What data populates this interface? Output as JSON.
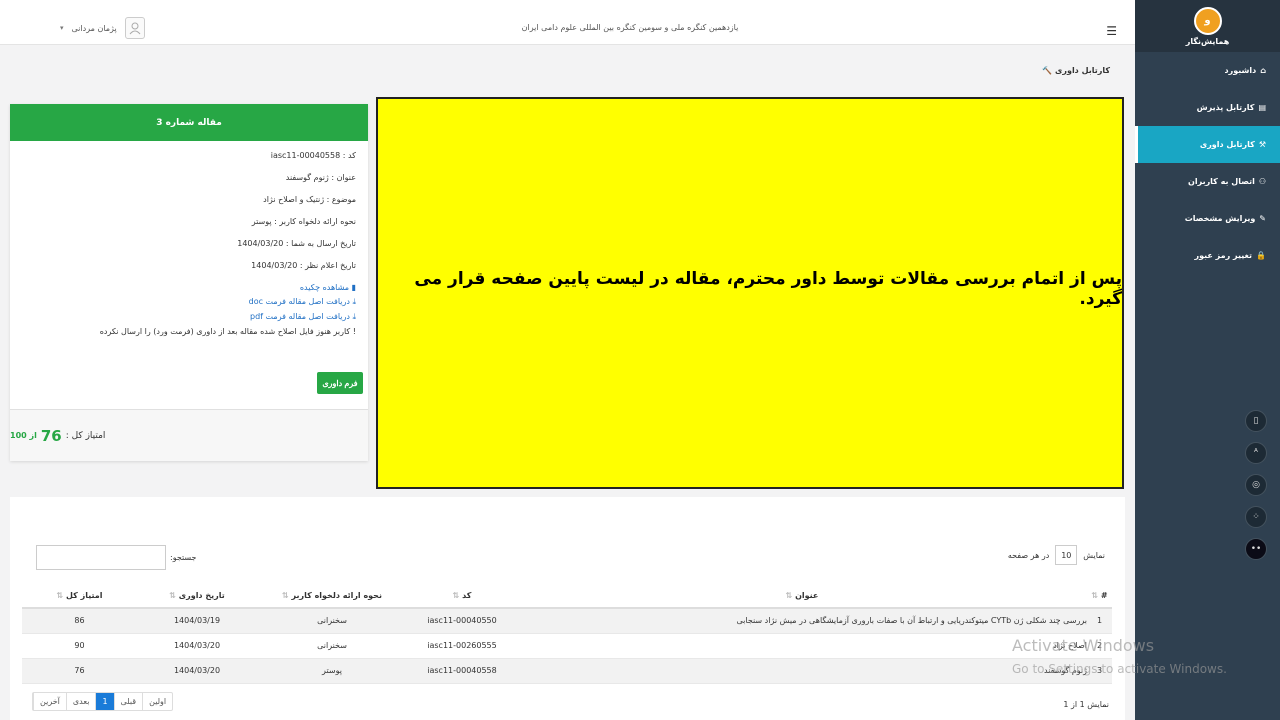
{
  "topbar": {
    "conference": "یازدهمین کنگره ملی و سومین کنگره بین المللی علوم دامی ایران",
    "user": "پژمان مردانی"
  },
  "breadcrumb": "کارتابل داوری",
  "sidebar": {
    "logo_text": "همایش‌نگار",
    "items": [
      {
        "label": "داشبورد",
        "icon": "home-icon"
      },
      {
        "label": "کارتابل پذیرش",
        "icon": "file-icon"
      },
      {
        "label": "کارتابل داوری",
        "icon": "gavel-icon",
        "active": true
      },
      {
        "label": "اتصال به کاربران",
        "icon": "users-icon"
      },
      {
        "label": "ویرایش مشخصات",
        "icon": "edit-icon"
      },
      {
        "label": "تغییر رمز عبور",
        "icon": "lock-icon"
      }
    ]
  },
  "card": {
    "title": "مقاله شماره 3",
    "code": "کد : iasc11-00040558",
    "title_field": "عنوان : ژنوم گوسفند",
    "subject": "موضوع : ژنتیک و اصلاح نژاد",
    "presentation": "نحوه ارائه دلخواه کاربر : پوستر",
    "sent_date": "تاریخ ارسال به شما : 1404/03/20",
    "opinion_date": "تاریخ اعلام نظر : 1404/03/20",
    "link_abstract": "مشاهده چکیده",
    "link_doc": "دریافت اصل مقاله فرمت doc",
    "link_pdf": "دریافت اصل مقاله فرمت pdf",
    "warning": "کاربر هنوز فایل اصلاح شده مقاله بعد از داوری (فرمت ورد) را ارسال نکرده",
    "review_button": "فرم داوری",
    "score_label": "امتیاز کل :",
    "score": "76",
    "score_of": "از 100"
  },
  "notice": "پس از اتمام بررسی مقالات توسط داور محترم، مقاله در لیست پایین صفحه قرار می گیرد.",
  "table": {
    "length_prefix": "نمایش",
    "length_value": "10",
    "length_suffix": "در هر صفحه",
    "search_label": "جستجو:",
    "headers": {
      "num": "#",
      "title": "عنوان",
      "code": "کد",
      "presentation": "نحوه ارائه دلخواه کاربر",
      "date": "تاریخ داوری",
      "score": "امتیاز کل"
    },
    "rows": [
      {
        "num": "1",
        "title": "بررسی چند شکلی ژن CYTb میتوکندریایی و ارتباط آن با صفات باروری آزمایشگاهی در میش نژاد سنجابی",
        "code": "iasc11-00040550",
        "presentation": "سخنرانی",
        "date": "1404/03/19",
        "score": "86"
      },
      {
        "num": "2",
        "title": "اصلاح نژاد",
        "code": "iasc11-00260555",
        "presentation": "سخنرانی",
        "date": "1404/03/20",
        "score": "90"
      },
      {
        "num": "3",
        "title": "ژنوم گوسفند",
        "code": "iasc11-00040558",
        "presentation": "پوستر",
        "date": "1404/03/20",
        "score": "76"
      }
    ],
    "info": "نمایش 1 از 1",
    "pager": {
      "first": "اولین",
      "prev": "قبلی",
      "current": "1",
      "next": "بعدی",
      "last": "آخرین"
    }
  },
  "watermark": {
    "line1": "Activate Windows",
    "line2": "Go to Settings to activate Windows."
  }
}
